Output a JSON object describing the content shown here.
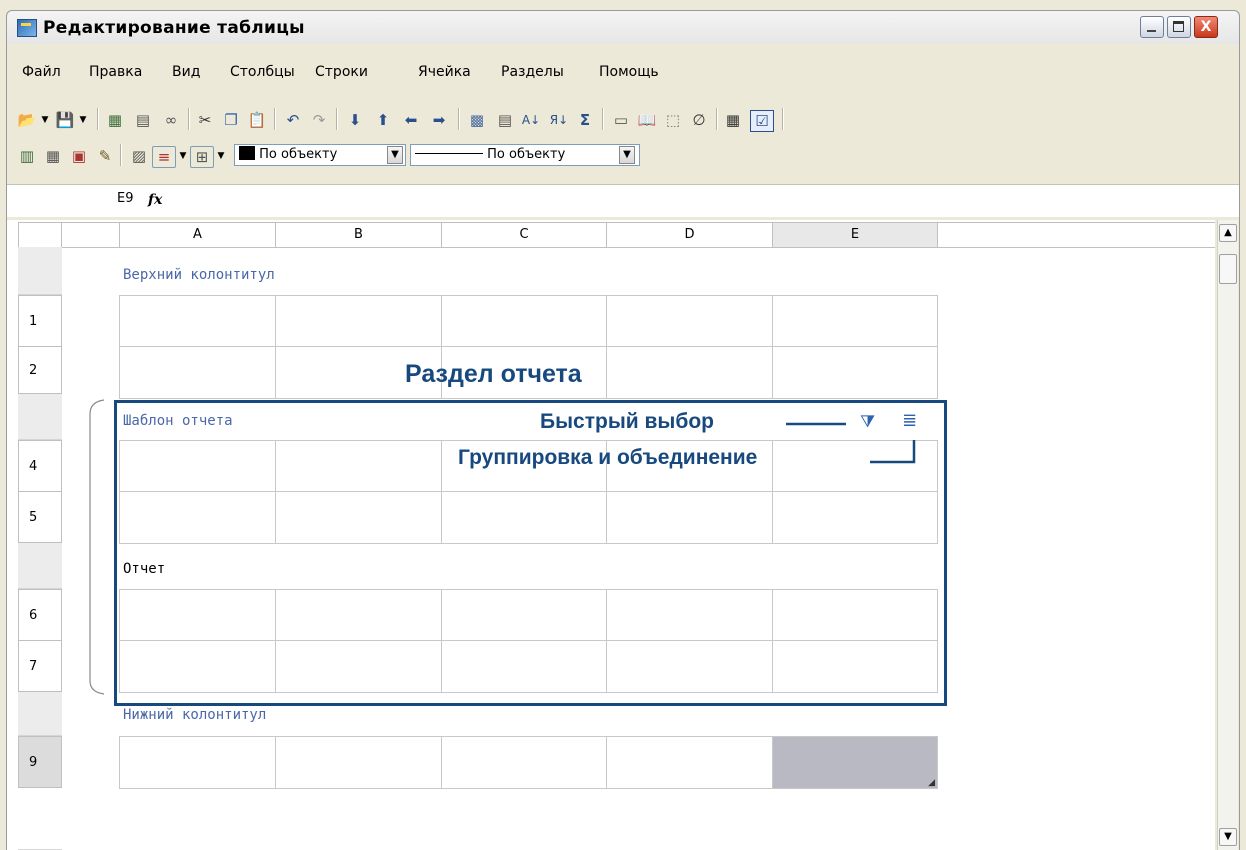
{
  "window": {
    "title": "Редактирование таблицы",
    "buttons": {
      "minimize": "_",
      "maximize": "□",
      "close": "X"
    }
  },
  "menu": [
    "Файл",
    "Правка",
    "Вид",
    "Столбцы",
    "Строки",
    "Ячейка",
    "Разделы",
    "Помощь"
  ],
  "toolbar": {
    "fill_combo": "По объекту",
    "line_combo": "По объекту"
  },
  "formula_bar": {
    "cell_ref": "E9",
    "fx": "fx"
  },
  "columns": [
    "A",
    "B",
    "C",
    "D",
    "E"
  ],
  "rows": {
    "r1": "1",
    "r2": "2",
    "r4": "4",
    "r5": "5",
    "r6": "6",
    "r7": "7",
    "r9": "9"
  },
  "sections": {
    "header": "Верхний колонтитул",
    "template": "Шаблон отчета",
    "report": "Отчет",
    "footer": "Нижний колонтитул"
  },
  "annotations": {
    "report_section": "Раздел отчета",
    "quick_select": "Быстрый выбор",
    "grouping": "Группировка и объединение"
  },
  "selected_cell": "E9",
  "colors": {
    "annotation": "#17497f",
    "section_label": "#4a68a8",
    "selection": "#b9b9c3"
  }
}
